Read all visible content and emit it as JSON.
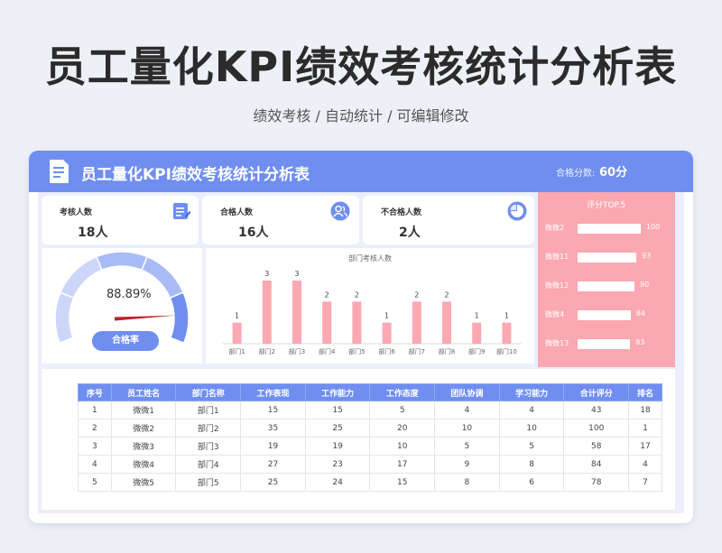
{
  "page": {
    "title": "员工量化KPI绩效考核统计分析表",
    "subtitle": "绩效考核 /  自动统计  /  可编辑修改"
  },
  "header": {
    "title": "员工量化KPI绩效考核统计分析表",
    "pass_score_label": "合格分数:",
    "pass_score_value": "60分"
  },
  "stats": [
    {
      "label": "考核人数",
      "value": "18人",
      "icon": "edit-doc-icon"
    },
    {
      "label": "合格人数",
      "value": "16人",
      "icon": "users-icon"
    },
    {
      "label": "不合格人数",
      "value": "2人",
      "icon": "pie-icon"
    }
  ],
  "gauge": {
    "percent_text": "88.89%",
    "value": 0.8889,
    "button_label": "合格率"
  },
  "top5": {
    "title": "评分TOP.5",
    "items": [
      {
        "name": "微微2",
        "value": 100
      },
      {
        "name": "微微11",
        "value": 93
      },
      {
        "name": "微微12",
        "value": 90
      },
      {
        "name": "微微4",
        "value": 84
      },
      {
        "name": "微微13",
        "value": 83
      }
    ]
  },
  "chart_data": {
    "type": "bar",
    "title": "部门考核人数",
    "categories": [
      "部门1",
      "部门2",
      "部门3",
      "部门4",
      "部门5",
      "部门6",
      "部门7",
      "部门8",
      "部门9",
      "部门10"
    ],
    "values": [
      1,
      3,
      3,
      2,
      2,
      1,
      2,
      2,
      1,
      1
    ],
    "ylim": [
      0,
      3
    ],
    "grid": false,
    "bar_color": "#fba8b2"
  },
  "table": {
    "headers": [
      "序号",
      "员工姓名",
      "部门名称",
      "工作表现",
      "工作能力",
      "工作态度",
      "团队协调",
      "学习能力",
      "合计评分",
      "排名"
    ],
    "rows": [
      [
        "1",
        "微微1",
        "部门1",
        "15",
        "15",
        "5",
        "4",
        "4",
        "43",
        "18"
      ],
      [
        "2",
        "微微2",
        "部门2",
        "35",
        "25",
        "20",
        "10",
        "10",
        "100",
        "1"
      ],
      [
        "3",
        "微微3",
        "部门3",
        "19",
        "19",
        "10",
        "5",
        "5",
        "58",
        "17"
      ],
      [
        "4",
        "微微4",
        "部门4",
        "27",
        "23",
        "17",
        "9",
        "8",
        "84",
        "4"
      ],
      [
        "5",
        "微微5",
        "部门5",
        "25",
        "24",
        "15",
        "8",
        "6",
        "78",
        "7"
      ]
    ]
  },
  "colors": {
    "accent": "#6f8ef0",
    "pink": "#fba8b2",
    "gauge_light": "#cdd6f8",
    "gauge_mid": "#a9bbf6",
    "needle": "#c0202a"
  }
}
